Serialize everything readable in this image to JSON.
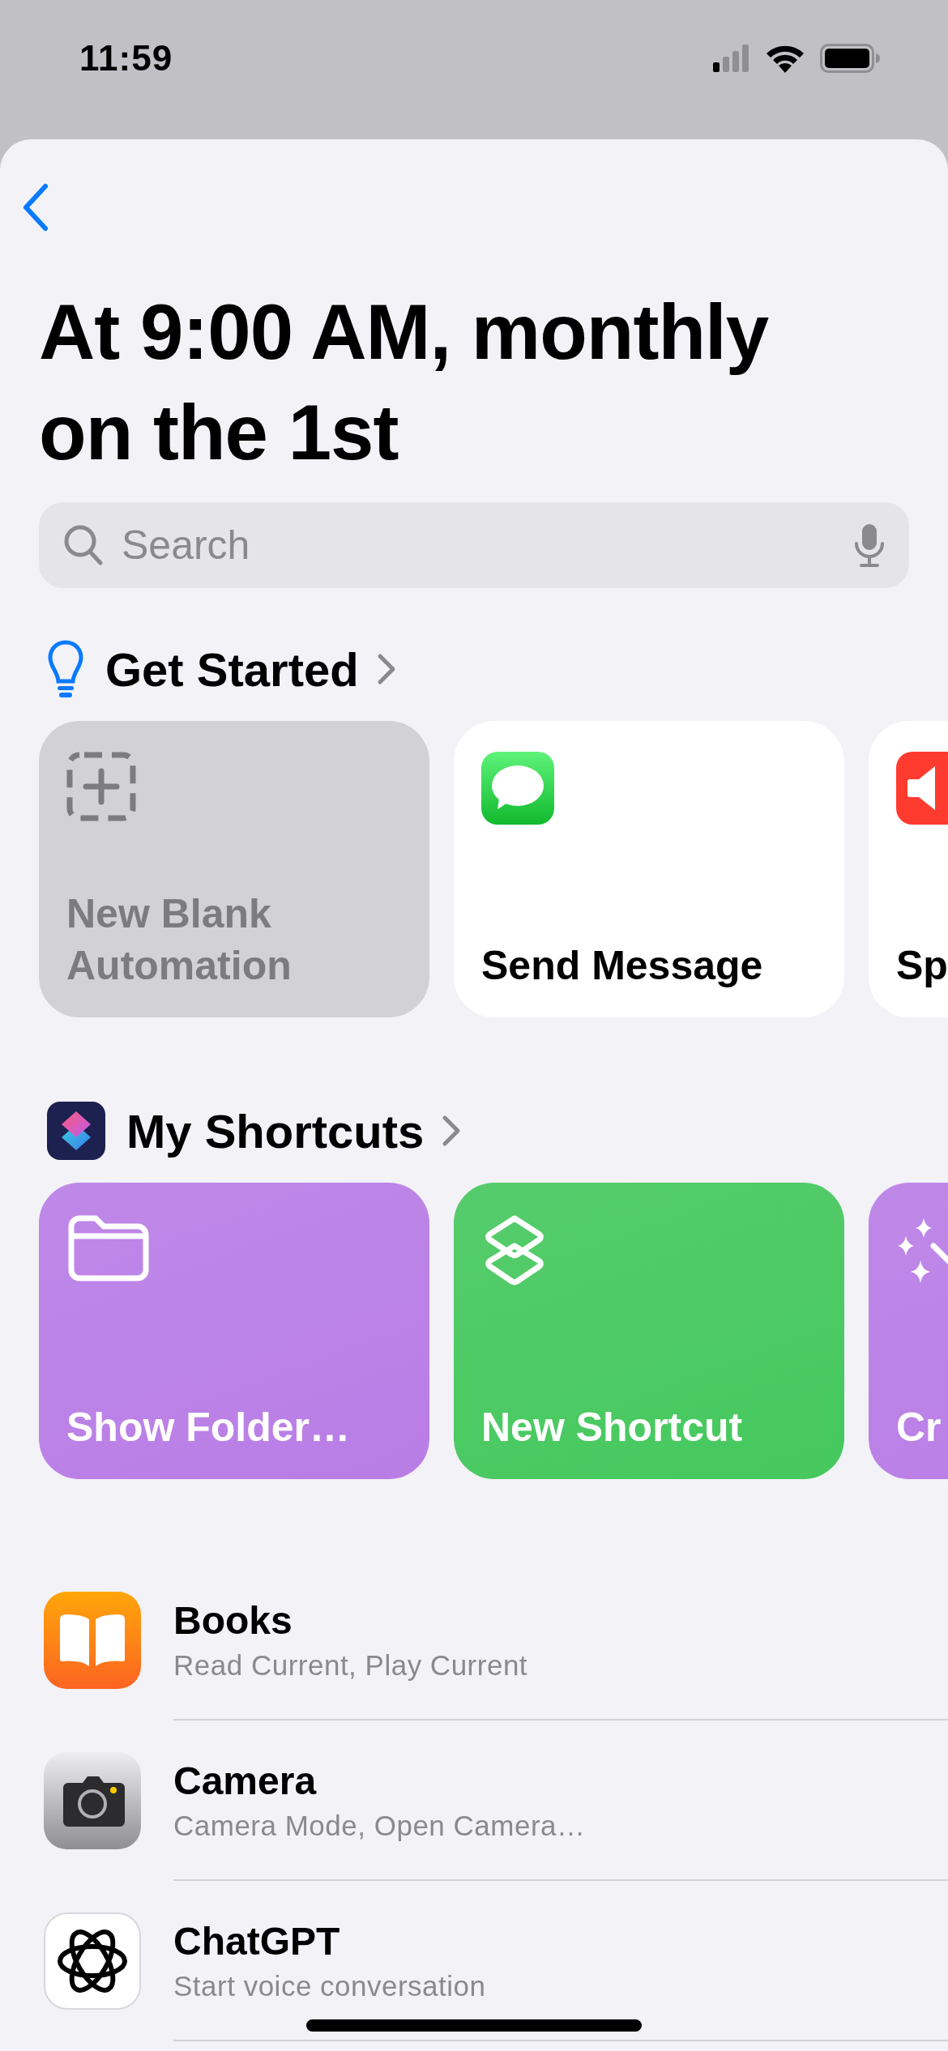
{
  "status_bar": {
    "time": "11:59"
  },
  "title": "At 9:00 AM, monthly on the 1st",
  "search": {
    "placeholder": "Search"
  },
  "sections": [
    {
      "kind": "bulb",
      "title": "Get Started",
      "cards": [
        {
          "kind": "blank",
          "label": "New Blank Automation"
        },
        {
          "kind": "messages",
          "label": "Send Message"
        },
        {
          "kind": "speaker",
          "label": "Sp"
        }
      ]
    },
    {
      "kind": "shortcuts",
      "title": "My Shortcuts",
      "cards": [
        {
          "kind": "folder",
          "label": "Show Folder…",
          "color": "#b97de6"
        },
        {
          "kind": "layers",
          "label": "New Shortcut",
          "color": "#45c85d"
        },
        {
          "kind": "sparkles",
          "label": "Cr",
          "color": "#b97de6"
        }
      ]
    }
  ],
  "apps": [
    {
      "kind": "books",
      "name": "Books",
      "actions": "Read Current, Play Current"
    },
    {
      "kind": "camera",
      "name": "Camera",
      "actions": "Camera Mode, Open Camera…"
    },
    {
      "kind": "chatgpt",
      "name": "ChatGPT",
      "actions": "Start voice conversation"
    }
  ]
}
